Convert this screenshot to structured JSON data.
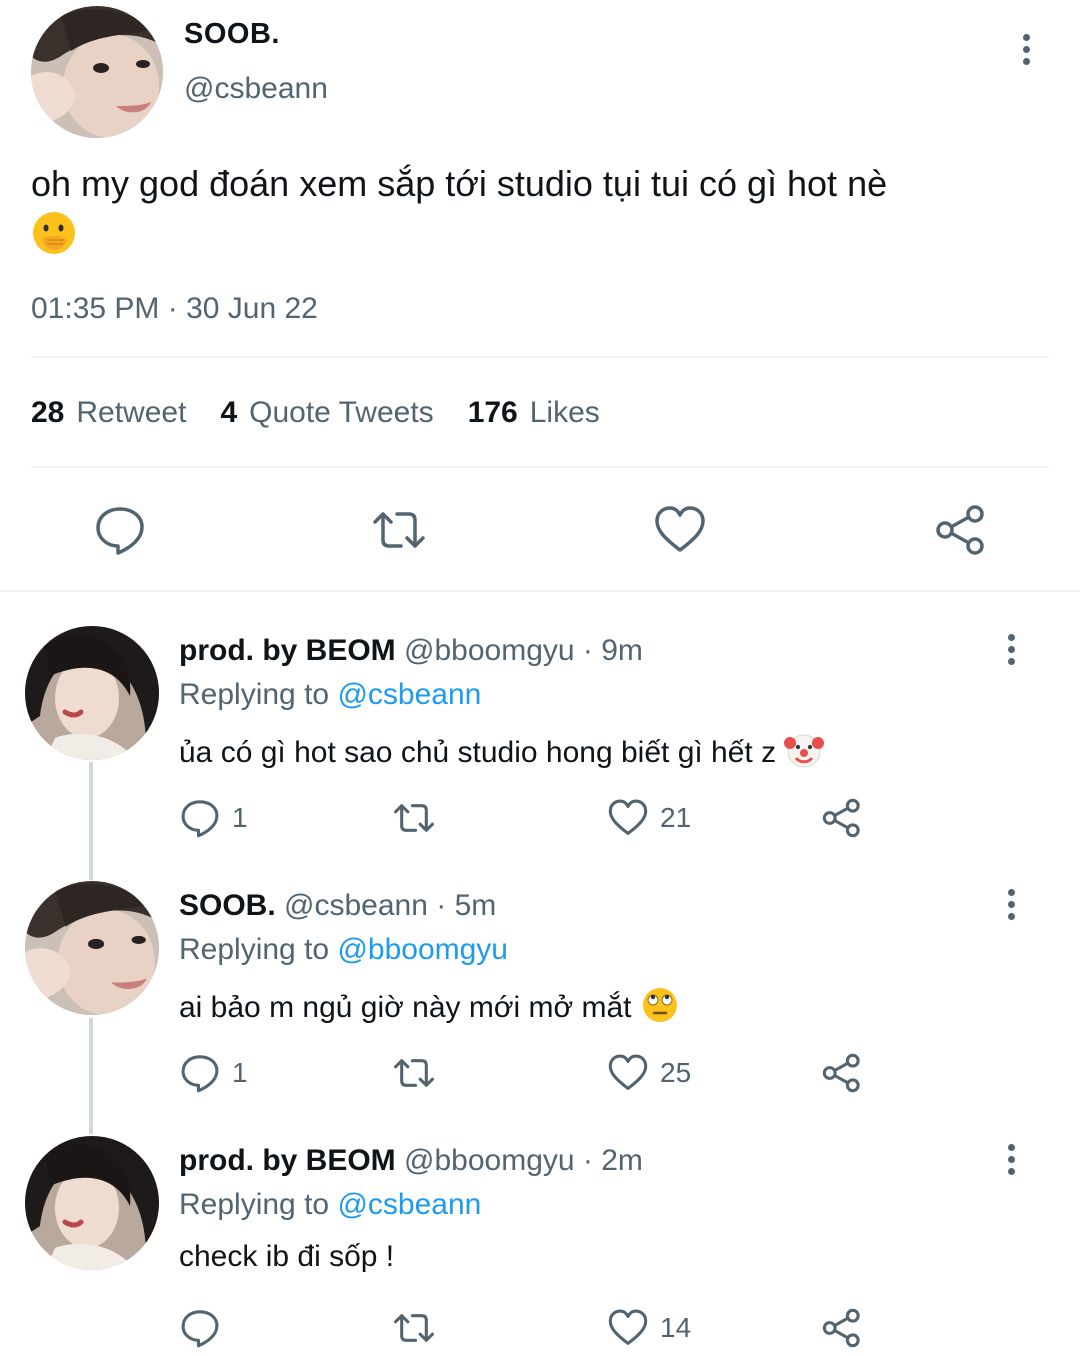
{
  "tweet": {
    "author_name": "SOOB.",
    "author_handle": "@csbeann",
    "text": "oh my god đoán xem sắp tới studio tụi tui có gì hot nè",
    "emoji": "hand-over-mouth-emoji",
    "timestamp": "01:35 PM · 30 Jun 22",
    "stats": {
      "retweet_count": "28",
      "retweet_label": "Retweet",
      "quote_count": "4",
      "quote_label": "Quote Tweets",
      "likes_count": "176",
      "likes_label": "Likes"
    }
  },
  "replies": [
    {
      "name": "prod. by BEOM",
      "handle_time": "@bboomgyu · 9m",
      "replying_prefix": "Replying to ",
      "replying_to": "@csbeann",
      "text": "ủa có gì hot sao chủ studio hong biết gì hết z",
      "emoji": "clown-emoji",
      "reply_count": "1",
      "like_count": "21"
    },
    {
      "name": "SOOB.",
      "handle_time": "@csbeann · 5m",
      "replying_prefix": "Replying to ",
      "replying_to": "@bboomgyu",
      "text": "ai bảo m ngủ giờ này mới mở mắt",
      "emoji": "eye-roll-emoji",
      "reply_count": "1",
      "like_count": "25"
    },
    {
      "name": "prod. by BEOM",
      "handle_time": "@bboomgyu · 2m",
      "replying_prefix": "Replying to ",
      "replying_to": "@csbeann",
      "text": "check ib đi sốp !",
      "emoji": "",
      "reply_count": "",
      "like_count": "14"
    }
  ],
  "colors": {
    "primary_text": "#0f1419",
    "secondary_text": "#536471",
    "link": "#1d9bf0",
    "divider": "#eff3f4"
  }
}
